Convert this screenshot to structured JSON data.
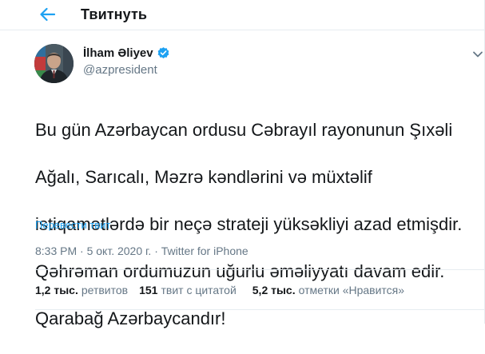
{
  "header": {
    "title": "Твитнуть"
  },
  "author": {
    "name": "İlham Əliyev",
    "handle": "@azpresident"
  },
  "tweet": {
    "lines": [
      "Bu gün Azərbaycan ordusu Cəbrayıl rayonunun Şıxəli",
      "Ağalı, Sarıcalı, Məzrə kəndlərini və müxtəlif",
      "istiqamətlərdə bir neçə strateji yüksəkliyi azad etmişdir.",
      "Qəhrəman ordumuzun uğurlu əməliyyatı davam edir.",
      "Qarabağ Azərbaycandır!"
    ],
    "translate_label": "Перевести твит",
    "time": "8:33 PM",
    "separator": "·",
    "date": "5 окт. 2020 г.",
    "source": "Twitter for iPhone"
  },
  "stats": {
    "retweets_count": "1,2 тыс.",
    "retweets_label": "ретвитов",
    "quotes_count": "151",
    "quotes_label": "твит с цитатой",
    "likes_count": "5,2 тыс.",
    "likes_label": "отметки «Нравится»"
  },
  "colors": {
    "accent": "#1da1f2",
    "text": "#14171a",
    "muted": "#657786",
    "border": "#e6ecf0"
  },
  "icons": {
    "back": "arrow-left-icon",
    "verified": "verified-badge-icon",
    "more": "chevron-down-icon"
  }
}
